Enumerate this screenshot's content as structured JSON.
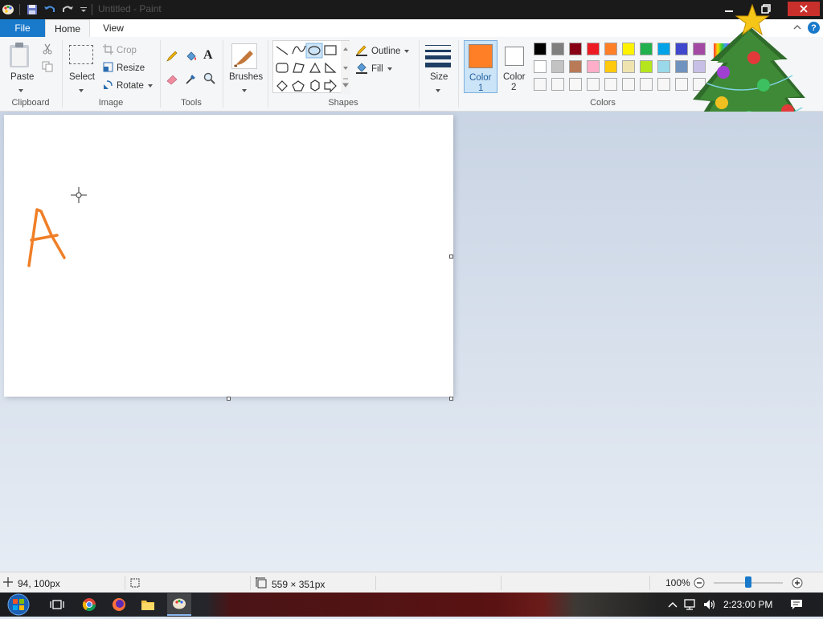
{
  "window": {
    "title": "Untitled - Paint"
  },
  "tabs": {
    "file": "File",
    "home": "Home",
    "view": "View"
  },
  "clipboard": {
    "paste": "Paste",
    "group": "Clipboard"
  },
  "image": {
    "select": "Select",
    "crop": "Crop",
    "resize": "Resize",
    "rotate": "Rotate",
    "group": "Image"
  },
  "tools": {
    "group": "Tools"
  },
  "brushes": {
    "label": "Brushes"
  },
  "shapes": {
    "outline": "Outline",
    "fill": "Fill",
    "group": "Shapes"
  },
  "size": {
    "label": "Size"
  },
  "color1": {
    "label": "Color",
    "num": "1",
    "value": "#ff7f27"
  },
  "color2": {
    "label": "Color",
    "num": "2",
    "value": "#ffffff"
  },
  "colors": {
    "group": "Colors",
    "row1": [
      "#000000",
      "#7f7f7f",
      "#880015",
      "#ed1c24",
      "#ff7f27",
      "#fff200",
      "#22b14c",
      "#00a2e8",
      "#3f48cc",
      "#a349a4"
    ],
    "row2": [
      "#ffffff",
      "#c3c3c3",
      "#b97a57",
      "#ffaec9",
      "#ffc90e",
      "#efe4b0",
      "#b5e61d",
      "#99d9ea",
      "#7092be",
      "#c8bfe7"
    ]
  },
  "canvas": {
    "drawing_letter": "A",
    "stroke_color": "#f07f27"
  },
  "status": {
    "cursor_pos": "94, 100px",
    "canvas_size": "559 × 351px",
    "zoom": "100%",
    "zoom_level": 0.5
  },
  "taskbar": {
    "time": "2:23:00 PM"
  }
}
